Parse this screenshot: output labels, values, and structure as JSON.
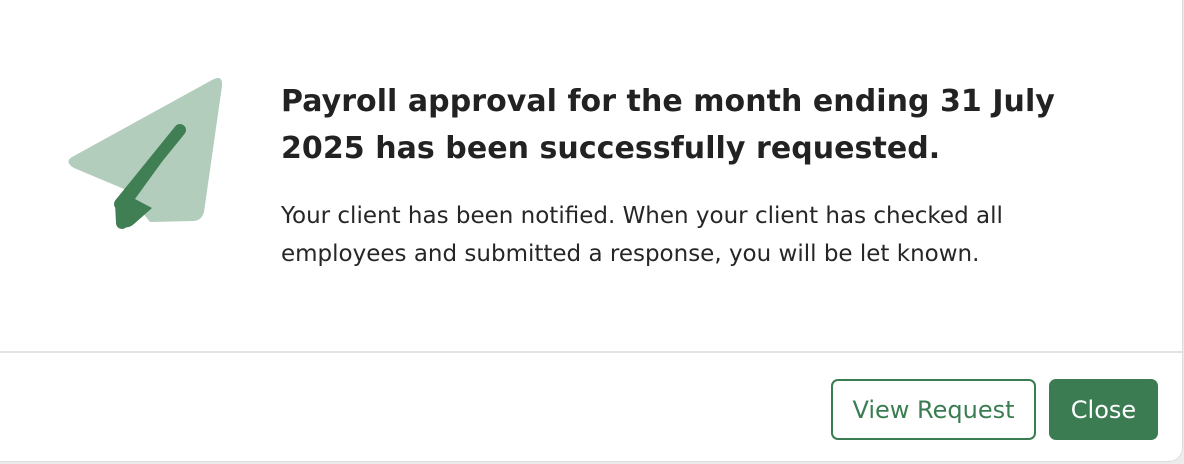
{
  "dialog": {
    "icon": "paper-plane-icon",
    "title": "Payroll approval for the month ending 31 July 2025 has been successfully requested.",
    "message": "Your client has been notified. When your client has checked all employees and submitted a response, you will be let known.",
    "buttons": {
      "view_request": "View Request",
      "close": "Close"
    }
  },
  "colors": {
    "accent": "#3b7c53",
    "icon_light": "#b3cdbd",
    "icon_dark": "#3f7f53"
  }
}
